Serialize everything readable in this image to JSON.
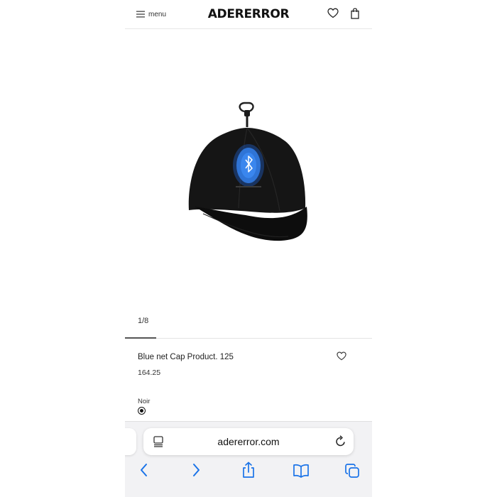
{
  "header": {
    "menu_label": "menu",
    "brand": "ADERERROR"
  },
  "gallery": {
    "counter": "1/8",
    "current": 1,
    "total": 8
  },
  "product": {
    "name": "Blue net Cap Product. 125",
    "price": "164.25",
    "color_label": "Noir",
    "selected_color": "#111111"
  },
  "browser": {
    "url": "adererror.com"
  },
  "colors": {
    "accent": "#1a73e8",
    "cap": "#111111",
    "patch": "#2f74d6"
  },
  "icons": [
    "hamburger-icon",
    "heart-icon",
    "bag-icon",
    "reader-mode-icon",
    "reload-icon",
    "back-icon",
    "forward-icon",
    "share-icon",
    "bookmarks-icon",
    "tabs-icon"
  ]
}
